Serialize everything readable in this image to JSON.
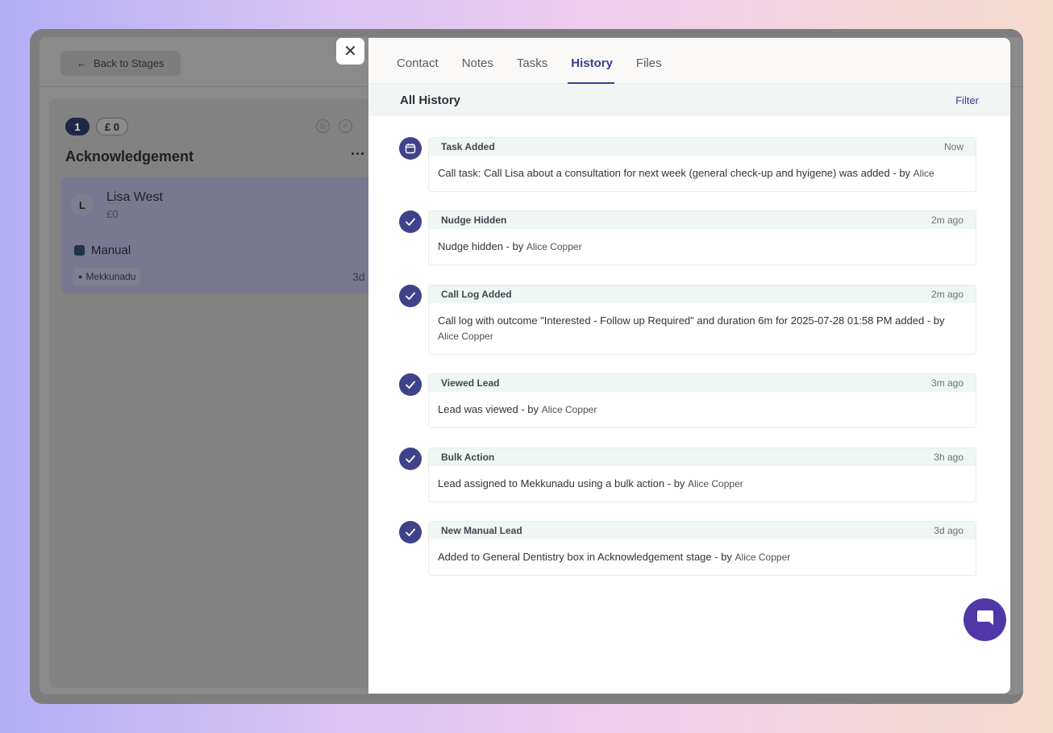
{
  "board": {
    "back_label": "Back to Stages",
    "column": {
      "count": "1",
      "value": "£ 0",
      "title": "Acknowledgement",
      "menu": "···"
    },
    "lead": {
      "avatar": "L",
      "name": "Lisa West",
      "value": "£0",
      "source": "Manual",
      "location": "Mekkunadu",
      "age": "3d"
    }
  },
  "panel": {
    "close": "✕",
    "tabs": [
      "Contact",
      "Notes",
      "Tasks",
      "History",
      "Files"
    ],
    "active_tab": "History",
    "subheader": {
      "title": "All History",
      "filter": "Filter"
    },
    "entries": [
      {
        "title": "Task Added",
        "time": "Now",
        "text": "Call task: Call Lisa about a consultation for next week (general check-up and hyigene) was added - by ",
        "by": "Alice",
        "icon": "calendar-icon"
      },
      {
        "title": "Nudge Hidden",
        "time": "2m ago",
        "text": "Nudge hidden - by ",
        "by": "Alice Copper",
        "icon": "check-icon"
      },
      {
        "title": "Call Log Added",
        "time": "2m ago",
        "text": "Call log with outcome \"Interested - Follow up Required\" and duration 6m for 2025-07-28 01:58 PM added - by ",
        "by": "Alice Copper",
        "icon": "check-icon"
      },
      {
        "title": "Viewed Lead",
        "time": "3m ago",
        "text": "Lead was viewed - by ",
        "by": "Alice Copper",
        "icon": "check-icon"
      },
      {
        "title": "Bulk Action",
        "time": "3h ago",
        "text": "Lead assigned to Mekkunadu using a bulk action - by ",
        "by": "Alice Copper",
        "icon": "check-icon"
      },
      {
        "title": "New Manual Lead",
        "time": "3d ago",
        "text": "Added to General Dentistry box in Acknowledgement stage - by ",
        "by": "Alice Copper",
        "icon": "check-icon"
      }
    ]
  },
  "colors": {
    "accent": "#3b3f8c",
    "icon_bg": "#3e4389",
    "chat": "#4f37a8"
  }
}
